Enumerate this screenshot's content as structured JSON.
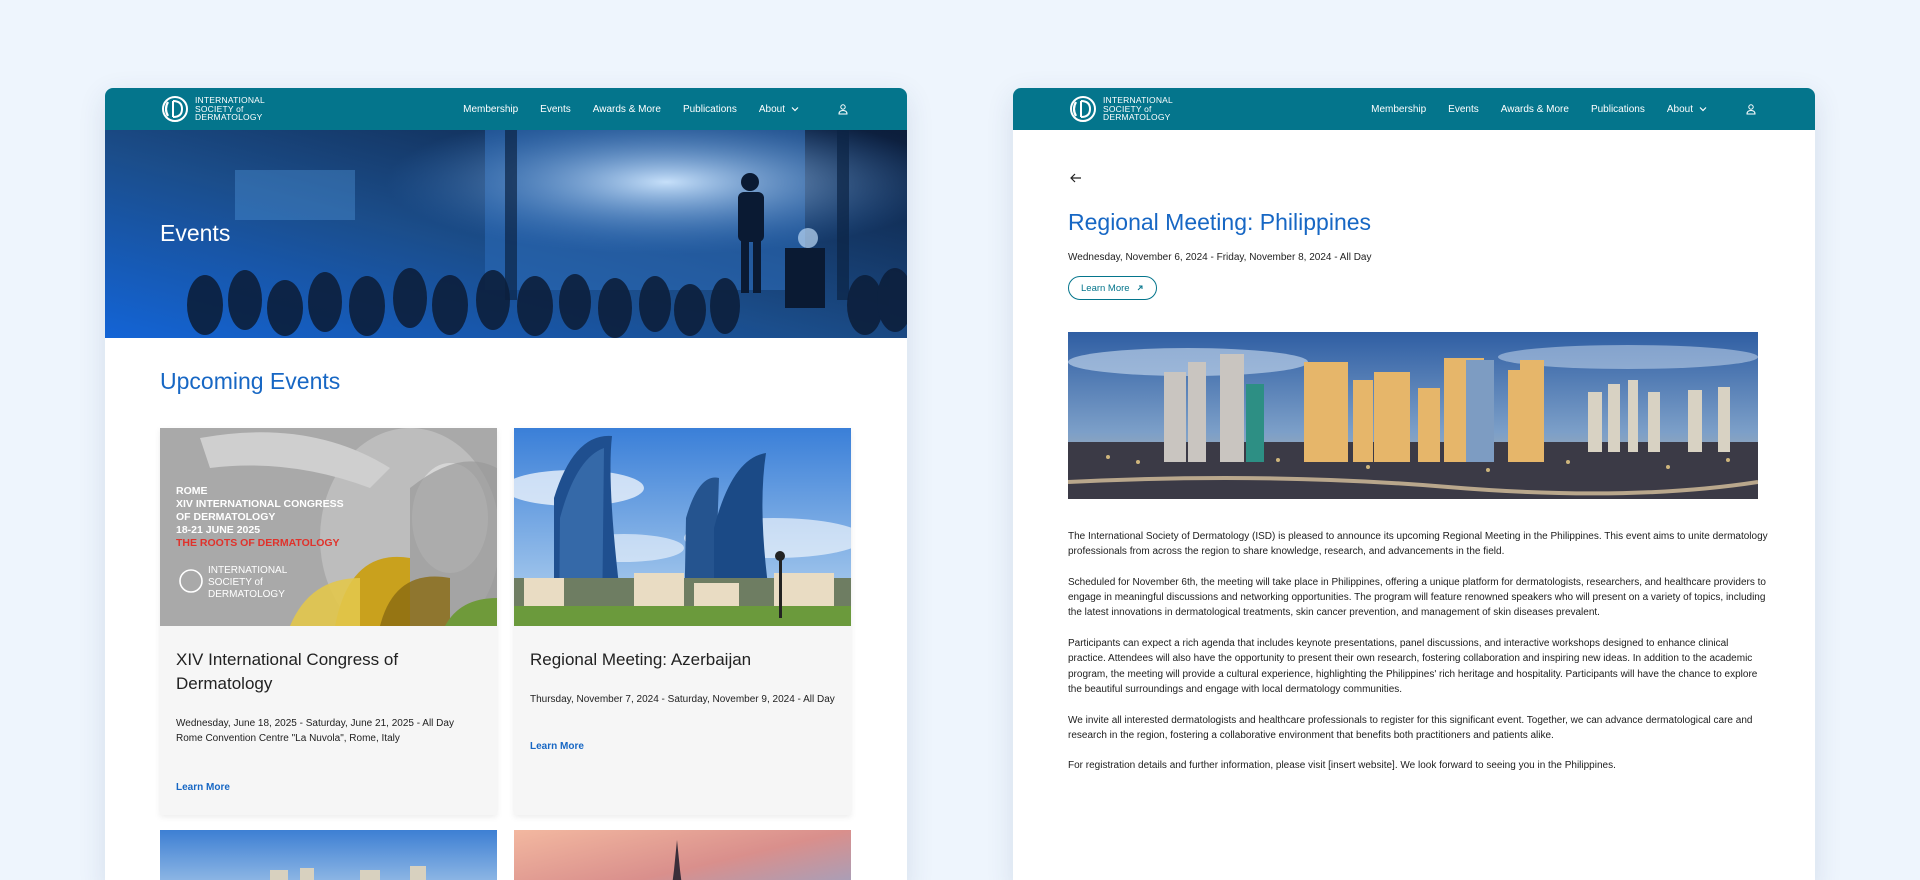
{
  "logo": {
    "lines": [
      "INTERNATIONAL",
      "SOCIETY of",
      "DERMATOLOGY"
    ]
  },
  "nav": {
    "items": [
      "Membership",
      "Events",
      "Awards & More",
      "Publications",
      "About"
    ]
  },
  "left": {
    "hero_title": "Events",
    "section_title": "Upcoming Events",
    "cards": [
      {
        "title": "XIV International Congress of Dermatology",
        "date": "Wednesday, June 18, 2025 - Saturday, June 21, 2025 - All Day Rome Convention Centre \"La Nuvola\", Rome, Italy",
        "link": "Learn More",
        "poster": {
          "lines": [
            "ROME",
            "XIV INTERNATIONAL CONGRESS",
            "OF DERMATOLOGY",
            "18-21 JUNE 2025"
          ],
          "red_line": "THE ROOTS OF DERMATOLOGY",
          "logo_lines": [
            "INTERNATIONAL",
            "SOCIETY of",
            "DERMATOLOGY"
          ]
        }
      },
      {
        "title": "Regional Meeting: Azerbaijan",
        "date": "Thursday, November 7, 2024 - Saturday, November 9, 2024 - All Day",
        "link": "Learn More"
      }
    ]
  },
  "right": {
    "title": "Regional Meeting: Philippines",
    "date": "Wednesday, November 6, 2024 - Friday, November 8, 2024 - All Day",
    "learn_more": "Learn More",
    "paragraphs": [
      "The International Society of Dermatology (ISD) is pleased to announce its upcoming Regional Meeting in the Philippines. This event aims to unite dermatology professionals from across the region to share knowledge, research, and advancements in the field.",
      "Scheduled for November 6th, the meeting will take place in Philippines, offering a unique platform for dermatologists, researchers, and healthcare providers to engage in meaningful discussions and networking opportunities. The program will feature renowned speakers who will present on a variety of topics, including the latest innovations in dermatological treatments, skin cancer prevention, and management of skin diseases prevalent.",
      "Participants can expect a rich agenda that includes keynote presentations, panel discussions, and interactive workshops designed to enhance clinical practice. Attendees will also have the opportunity to present their own research, fostering collaboration and inspiring new ideas. In addition to the academic program, the meeting will provide a cultural experience, highlighting the Philippines' rich heritage and hospitality. Participants will have the chance to explore the beautiful surroundings and engage with local dermatology communities.",
      "We invite all interested dermatologists and healthcare professionals to register for this significant event. Together, we can advance dermatological care and research in the region, fostering a collaborative environment that benefits both practitioners and patients alike.",
      "For registration details and further information, please visit [insert website]. We look forward to seeing you in the Philippines."
    ]
  },
  "colors": {
    "nav_bg": "#04758c",
    "accent_blue": "#1767c4",
    "page_bg": "#eef5fd"
  },
  "icons": [
    "isd-logo-icon",
    "chevron-down-icon",
    "user-icon",
    "back-arrow-icon",
    "external-link-icon"
  ]
}
